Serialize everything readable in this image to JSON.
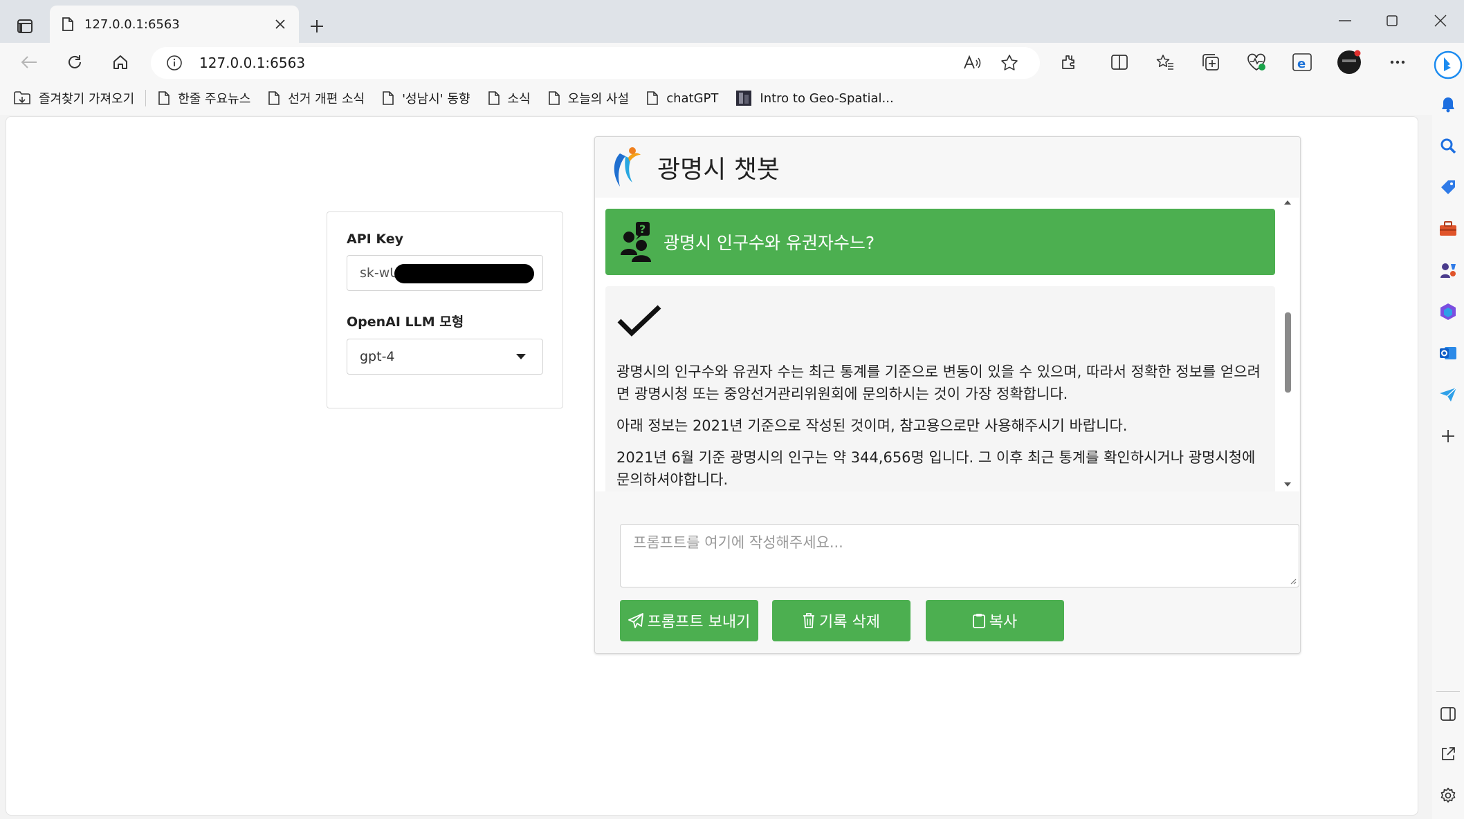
{
  "browser": {
    "tab_title": "127.0.0.1:6563",
    "url": "127.0.0.1:6563",
    "bookmarks": [
      {
        "label": "즐겨찾기 가져오기",
        "icon": "import-favorites-icon"
      },
      {
        "label": "한줄 주요뉴스",
        "icon": "page-icon"
      },
      {
        "label": "선거 개편 소식",
        "icon": "page-icon"
      },
      {
        "label": "'성남시' 동향",
        "icon": "page-icon"
      },
      {
        "label": "소식",
        "icon": "page-icon"
      },
      {
        "label": "오늘의 사설",
        "icon": "page-icon"
      },
      {
        "label": "chatGPT",
        "icon": "page-icon"
      },
      {
        "label": "Intro to Geo-Spatial...",
        "icon": "site-favicon"
      }
    ]
  },
  "settings": {
    "api_key_label": "API Key",
    "api_key_value": "sk-wU",
    "model_label": "OpenAI LLM 모형",
    "model_selected": "gpt-4"
  },
  "chat": {
    "title": "광명시 챗봇",
    "user_message": "광명시 인구수와 유권자수느?",
    "bot_paragraphs": [
      "광명시의 인구수와 유권자 수는 최근 통계를 기준으로 변동이 있을 수 있으며, 따라서 정확한 정보를 얻으려면 광명시청 또는 중앙선거관리위원회에 문의하시는 것이 가장 정확합니다.",
      "아래 정보는 2021년 기준으로 작성된 것이며, 참고용으로만 사용해주시기 바랍니다.",
      "2021년 6월 기준 광명시의 인구는 약 344,656명 입니다. 그 이후 최근 통계를 확인하시거나 광명시청에 문의하셔야합니다."
    ],
    "prompt_placeholder": "프롬프트를 여기에 작성해주세요...",
    "send_label": "프롬프트 보내기",
    "clear_label": "기록 삭제",
    "copy_label": "복사"
  },
  "colors": {
    "accent_green": "#4caf50"
  }
}
